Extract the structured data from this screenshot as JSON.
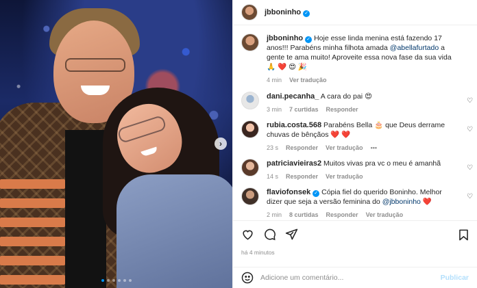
{
  "post": {
    "author": "jbboninho",
    "caption_parts": [
      "Hoje esse linda menina está fazendo 17 anos!!! Parabéns minha filhota amada ",
      " a gente te ama muito! Aproveite essa nova fase da sua vida ",
      ""
    ],
    "caption_mention": "@abellafurtado",
    "caption_emojis": "🙏 ❤️ 😍 🎉",
    "time": "4 min",
    "see_translation": "Ver tradução",
    "posted_ago": "há 4 minutos",
    "carousel": {
      "current": 1,
      "total": 6
    }
  },
  "comments": [
    {
      "user": "dani.pecanha_",
      "verified": false,
      "text": " A cara do pai 😍",
      "time": "3 min",
      "likes": "7 curtidas",
      "reply": "Responder"
    },
    {
      "user": "rubia.costa.568",
      "verified": false,
      "text": " Parabéns Bella 🎂 que Deus derrame chuvas de bênçãos ❤️ ❤️",
      "time": "23 s",
      "reply": "Responder",
      "translate": "Ver tradução",
      "more": "•••"
    },
    {
      "user": "patriciavieiras2",
      "verified": false,
      "text": " Muitos vivas pra vc o meu é amanhã",
      "time": "14 s",
      "reply": "Responder",
      "translate": "Ver tradução"
    },
    {
      "user": "flaviofonsek",
      "verified": true,
      "text_before": " Cópia fiel do querido Boninho. Melhor dizer que seja a versão feminina do ",
      "mention": "@jbboninho",
      "text_after": " ❤️",
      "time": "2 min",
      "likes": "8 curtidas",
      "reply": "Responder",
      "translate": "Ver tradução"
    }
  ],
  "add_comment": {
    "placeholder": "Adicione um comentário...",
    "publish": "Publicar"
  },
  "icons": [
    "heart-icon",
    "comment-icon",
    "share-icon",
    "bookmark-icon",
    "emoji-icon",
    "chevron-right-icon"
  ],
  "colors": {
    "accent": "#0095f6",
    "mention": "#00376b",
    "muted": "#8e8e8e",
    "publish_disabled": "#b2dffc"
  }
}
